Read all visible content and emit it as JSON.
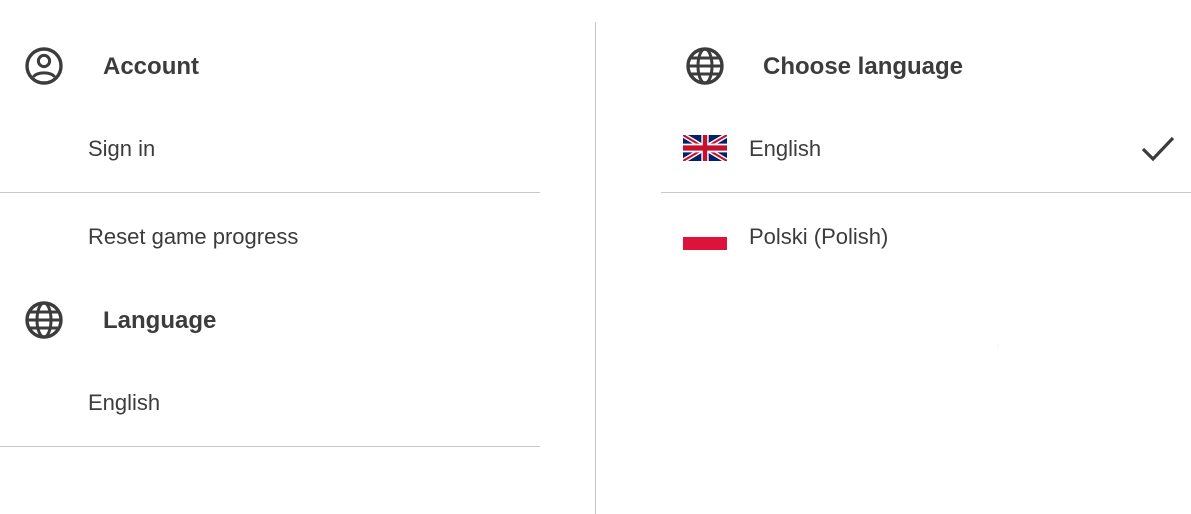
{
  "left_panel": {
    "account": {
      "title": "Account",
      "icon": "account-circle-icon",
      "items": [
        {
          "label": "Sign in"
        },
        {
          "label": "Reset game progress"
        }
      ]
    },
    "language": {
      "title": "Language",
      "icon": "globe-icon",
      "current_value": "English"
    }
  },
  "right_panel": {
    "title": "Choose language",
    "icon": "globe-icon",
    "options": [
      {
        "label": "English",
        "flag": "uk-flag-icon",
        "selected": true
      },
      {
        "label": "Polski (Polish)",
        "flag": "poland-flag-icon",
        "selected": false
      }
    ]
  },
  "colors": {
    "text": "#3c3c3c",
    "divider": "#c9c9c9",
    "poland_red": "#dc143c",
    "uk_blue": "#012169",
    "uk_red": "#c8102e"
  }
}
